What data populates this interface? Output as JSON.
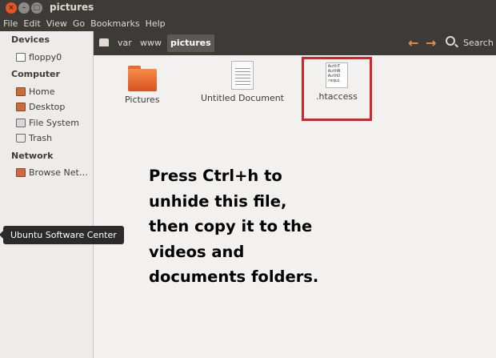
{
  "window": {
    "title": "pictures"
  },
  "menubar": [
    "File",
    "Edit",
    "View",
    "Go",
    "Bookmarks",
    "Help"
  ],
  "sidebar": {
    "devices_header": "Devices",
    "devices": [
      {
        "label": "floppy0",
        "icon": "floppy-icon"
      }
    ],
    "computer_header": "Computer",
    "computer": [
      {
        "label": "Home",
        "icon": "home-folder-icon"
      },
      {
        "label": "Desktop",
        "icon": "desktop-folder-icon"
      },
      {
        "label": "File System",
        "icon": "file-system-icon"
      },
      {
        "label": "Trash",
        "icon": "trash-icon"
      }
    ],
    "network_header": "Network",
    "network": [
      {
        "label": "Browse Net…",
        "icon": "network-icon"
      }
    ]
  },
  "toolbar": {
    "breadcrumbs": [
      "var",
      "www"
    ],
    "current": "pictures",
    "back_arrow": "←",
    "forward_arrow": "→",
    "search_label": "Search"
  },
  "files": [
    {
      "label": "Pictures",
      "icon": "folder-icon"
    },
    {
      "label": "Untitled Document",
      "icon": "document-icon"
    },
    {
      "label": ".htaccess",
      "icon": "text-file-icon",
      "preview_lines": [
        "AuthT",
        "AuthN",
        "AuthU",
        "requi"
      ]
    }
  ],
  "instruction": "Press Ctrl+h to\nunhide this file,\nthen copy it to the\nvideos and\ndocuments folders.",
  "tooltip": "Ubuntu Software Center",
  "colors": {
    "accent": "#e95420",
    "highlight": "#d0262a",
    "titlebar": "#3c3b37"
  }
}
